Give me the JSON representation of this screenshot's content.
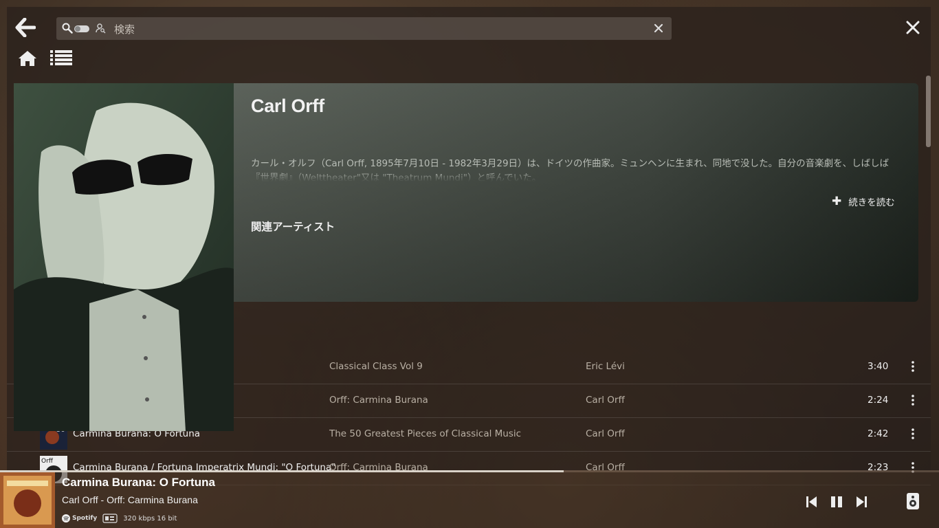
{
  "search": {
    "placeholder": "検索",
    "value": ""
  },
  "artist": {
    "name": "Carl Orff",
    "bio": "カール・オルフ（Carl Orff, 1895年7月10日 - 1982年3月29日）は、ドイツの作曲家。ミュンヘンに生まれ、同地で没した。自分の音楽劇を、しばしば『世界劇』（Welttheater\"又は \"Theatrum Mundi\"）と呼んでいた。",
    "read_more": "続きを読む",
    "related_heading": "関連アーティスト"
  },
  "tracks": [
    {
      "title": "",
      "album": "Classical Class Vol 9",
      "artist": "Eric Lévi",
      "duration": "3:40"
    },
    {
      "title": "",
      "album": "Orff: Carmina Burana",
      "artist": "Carl Orff",
      "duration": "2:24"
    },
    {
      "title": "Carmina Burana: O Fortuna",
      "album": "The 50 Greatest Pieces of Classical Music",
      "artist": "Carl Orff",
      "duration": "2:42"
    },
    {
      "title": "Carmina Burana / Fortuna Imperatrix Mundi: \"O Fortuna\"",
      "album": "Orff: Carmina Burana",
      "artist": "Carl Orff",
      "duration": "2:23"
    }
  ],
  "player": {
    "title": "Carmina Burana: O Fortuna",
    "subtitle": "Carl Orff - Orff: Carmina Burana",
    "service": "Spotify",
    "quality": "320 kbps 16 bit",
    "progress": 0.6
  },
  "icons": {
    "back": "arrow-left",
    "search": "magnifier",
    "toggle": "toggle-switch",
    "user": "user-search",
    "clear": "x",
    "close": "x",
    "home": "house",
    "queue": "list",
    "more": "vertical-dots",
    "prev": "skip-back",
    "pause": "pause",
    "next": "skip-forward",
    "speaker": "speaker"
  }
}
